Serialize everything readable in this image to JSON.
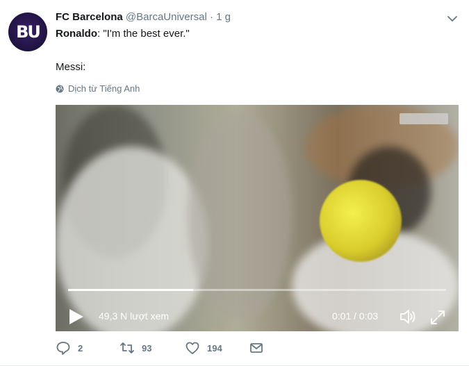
{
  "account": {
    "avatar_text": "BU",
    "name": "FC Barcelona",
    "handle": "@BarcaUniversal",
    "dot": "·",
    "time": "1 g"
  },
  "tweet": {
    "speaker": "Ronaldo",
    "quote_rest": ": \"I'm the best ever.\"",
    "line2": "Messi:"
  },
  "translate": {
    "label": "Dịch từ Tiếng Anh"
  },
  "video": {
    "progress_fraction": 0.33,
    "views": "49,3 N lượt xem",
    "time": "0:01 / 0:03"
  },
  "actions": {
    "replies": "2",
    "retweets": "93",
    "likes": "194"
  },
  "colors": {
    "text": "#14171a",
    "secondary": "#657786",
    "divider": "#e6ecf0"
  },
  "icons": [
    "chevron-down-icon",
    "globe-icon",
    "play-icon",
    "volume-icon",
    "expand-icon",
    "reply-icon",
    "retweet-icon",
    "like-icon",
    "message-icon"
  ]
}
